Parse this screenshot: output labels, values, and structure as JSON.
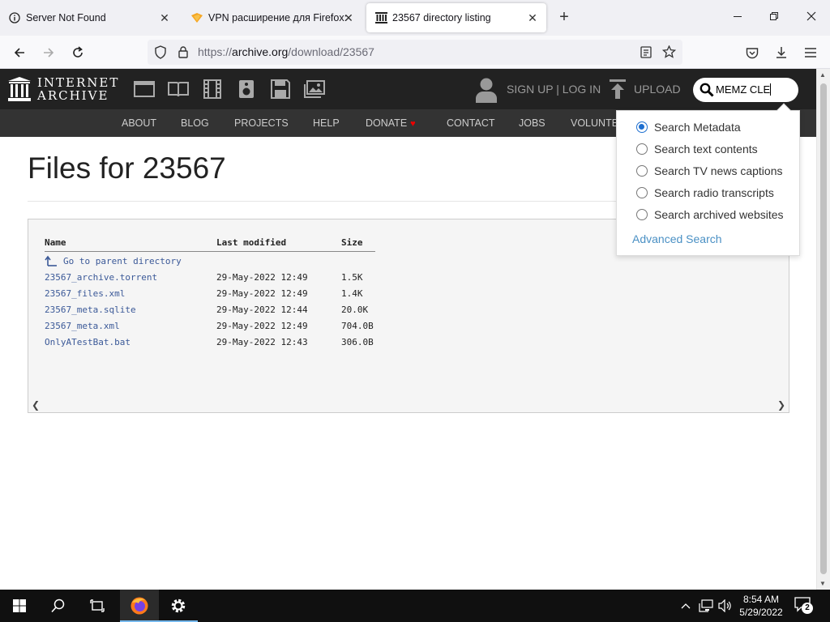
{
  "browser": {
    "tabs": [
      {
        "label": "Server Not Found",
        "icon": "info-icon",
        "active": false
      },
      {
        "label": "VPN расширение для Firefox: ",
        "icon": "vpn-shield-icon",
        "active": false
      },
      {
        "label": "23567 directory listing",
        "icon": "archive-icon",
        "active": true
      }
    ],
    "url_prefix": "https://",
    "url_domain": "archive.org",
    "url_path": "/download/23567"
  },
  "ia_header": {
    "logo_line1": "INTERNET",
    "logo_line2": "ARCHIVE",
    "signup_login": "SIGN UP | LOG IN",
    "upload": "UPLOAD",
    "search_value": "MEMZ CLE"
  },
  "ia_nav": [
    "ABOUT",
    "BLOG",
    "PROJECTS",
    "HELP",
    "DONATE",
    "CONTACT",
    "JOBS",
    "VOLUNTE"
  ],
  "search_dropdown": {
    "options": [
      {
        "label": "Search Metadata",
        "checked": true
      },
      {
        "label": "Search text contents",
        "checked": false
      },
      {
        "label": "Search TV news captions",
        "checked": false
      },
      {
        "label": "Search radio transcripts",
        "checked": false
      },
      {
        "label": "Search archived websites",
        "checked": false
      }
    ],
    "advanced": "Advanced Search"
  },
  "page": {
    "title": "Files for 23567",
    "columns": [
      "Name",
      "Last modified",
      "Size"
    ],
    "parent_link": "Go to parent directory",
    "files": [
      {
        "name": "23567_archive.torrent",
        "modified": "29-May-2022 12:49",
        "size": "1.5K"
      },
      {
        "name": "23567_files.xml",
        "modified": "29-May-2022 12:49",
        "size": "1.4K"
      },
      {
        "name": "23567_meta.sqlite",
        "modified": "29-May-2022 12:44",
        "size": "20.0K"
      },
      {
        "name": "23567_meta.xml",
        "modified": "29-May-2022 12:49",
        "size": "704.0B"
      },
      {
        "name": "OnlyATestBat.bat",
        "modified": "29-May-2022 12:43",
        "size": "306.0B"
      }
    ]
  },
  "taskbar": {
    "time": "8:54 AM",
    "date": "5/29/2022",
    "notifications": "2"
  }
}
